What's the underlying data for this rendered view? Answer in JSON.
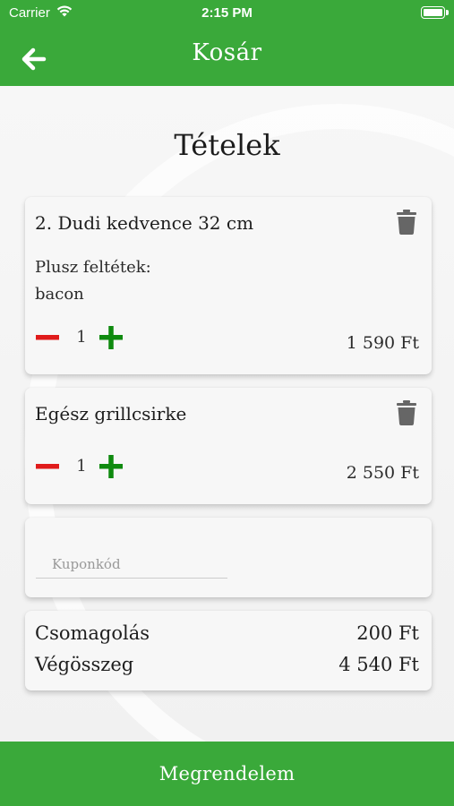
{
  "status_bar": {
    "carrier": "Carrier",
    "time": "2:15 PM"
  },
  "header": {
    "title": "Kosár"
  },
  "section_title": "Tételek",
  "items": [
    {
      "name": "2. Dudi kedvence 32 cm",
      "extras_label": "Plusz feltétek:",
      "extras_value": "bacon",
      "quantity": "1",
      "price": "1 590 Ft"
    },
    {
      "name": "Egész grillcsirke",
      "quantity": "1",
      "price": "2 550 Ft"
    }
  ],
  "coupon": {
    "placeholder": "Kuponkód",
    "value": ""
  },
  "summary": {
    "packaging_label": "Csomagolás",
    "packaging_value": "200 Ft",
    "total_label": "Végösszeg",
    "total_value": "4 540 Ft"
  },
  "order_button": "Megrendelem",
  "colors": {
    "accent_green": "#3aa93a",
    "minus_red": "#e01b1b",
    "plus_green": "#0f8a0f",
    "trash_gray": "#666666"
  }
}
